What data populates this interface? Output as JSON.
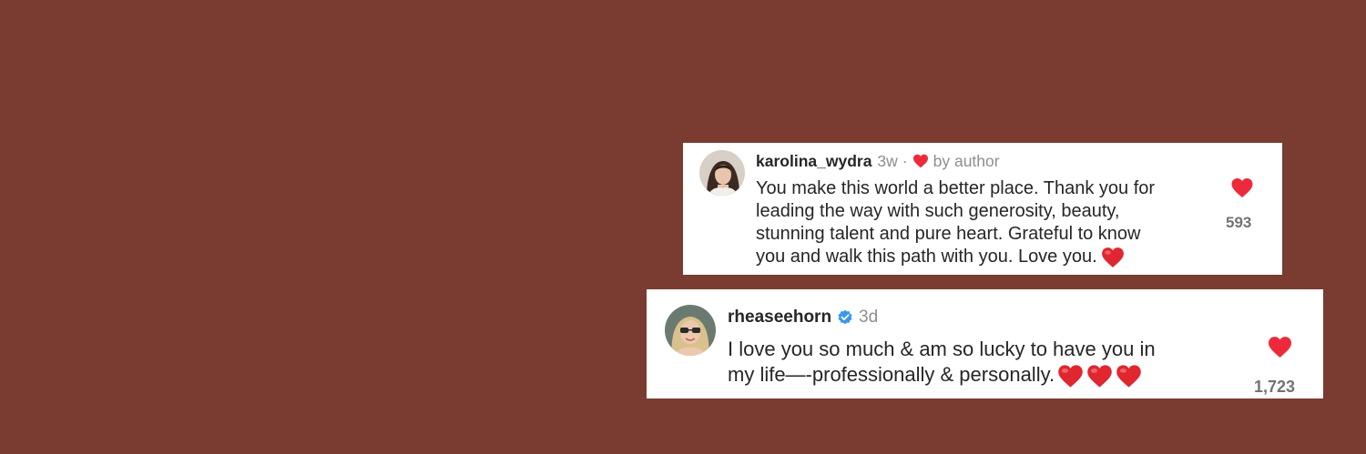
{
  "colors": {
    "background": "#7a3b31",
    "card": "#ffffff",
    "heart": "#ed2a3b",
    "verified": "#3897f0",
    "username": "#262626",
    "muted": "#8e8e8e"
  },
  "comments": [
    {
      "username": "karolina_wydra",
      "time": "3w",
      "separator": "·",
      "liked_by_author_icon": "heart-icon",
      "byline": "by author",
      "verified": false,
      "text_lines": [
        "You make this world a better place. Thank you for",
        "leading the way with such generosity, beauty,",
        "stunning talent and pure heart. Grateful to know",
        "you and walk this path with you. Love you."
      ],
      "trailing_emoji": "red-heart-emoji",
      "likes": "593"
    },
    {
      "username": "rheaseehorn",
      "time": "3d",
      "verified": true,
      "verified_icon": "verified-badge-icon",
      "text_lines": [
        "I love you so much & am so lucky to have you in",
        "my life—-professionally & personally."
      ],
      "trailing_emoji": "red-heart-emoji x3",
      "likes": "1,723"
    }
  ]
}
